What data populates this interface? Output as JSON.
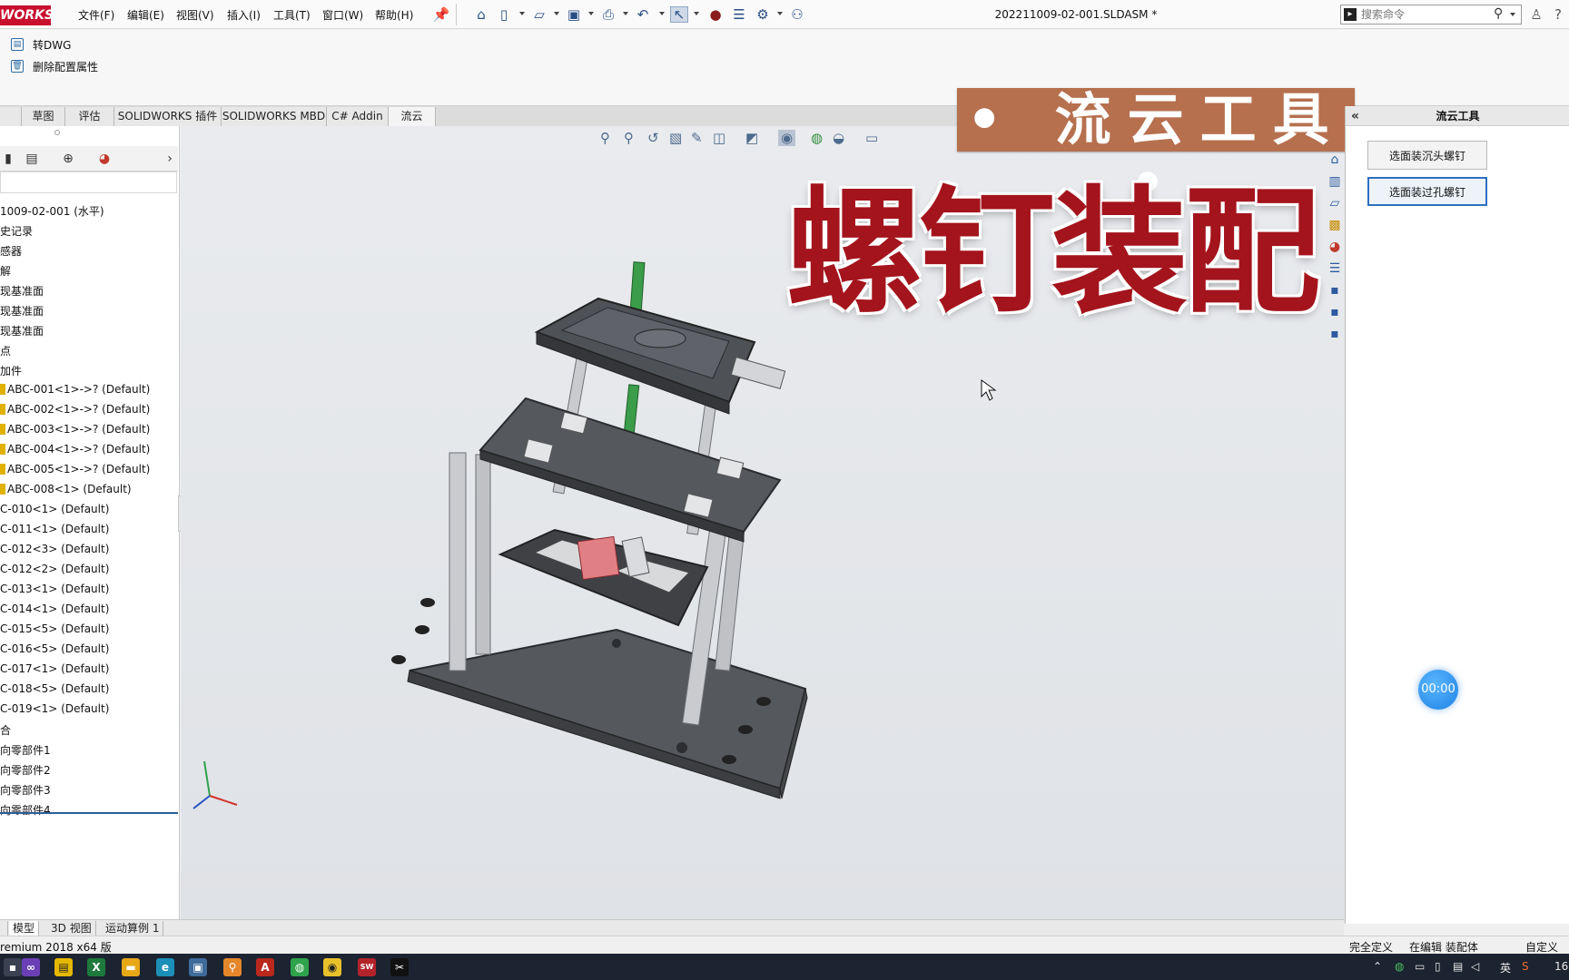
{
  "titlebar": {
    "brand": "WORKS",
    "menus": [
      "文件(F)",
      "编辑(E)",
      "视图(V)",
      "插入(I)",
      "工具(T)",
      "窗口(W)",
      "帮助(H)"
    ],
    "document_title": "202211009-02-001.SLDASM *",
    "search_placeholder": "搜索命令"
  },
  "ribbon": {
    "items": [
      {
        "label": "转DWG",
        "icon": "document-icon"
      },
      {
        "label": "删除配置属性",
        "icon": "trash-icon"
      }
    ]
  },
  "command_tabs": [
    "草图",
    "评估",
    "SOLIDWORKS 插件",
    "SOLIDWORKS MBD",
    "C# Addin",
    "流云"
  ],
  "active_tab": "流云",
  "feature_tree": {
    "items": [
      "1009-02-001  (水平)",
      "史记录",
      "感器",
      "解",
      "现基准面",
      "现基准面",
      "现基准面",
      "点",
      "加件",
      "ABC-001<1>->? (Default)",
      "ABC-002<1>->? (Default)",
      "ABC-003<1>->? (Default)",
      "ABC-004<1>->? (Default)",
      "ABC-005<1>->? (Default)",
      "ABC-008<1> (Default)",
      "C-010<1> (Default)",
      "C-011<1> (Default)",
      "C-012<3> (Default)",
      "C-012<2> (Default)",
      "C-013<1> (Default)",
      "C-014<1> (Default)",
      "C-015<5> (Default)",
      "C-016<5> (Default)",
      "C-017<1> (Default)",
      "C-018<5> (Default)",
      "C-019<1> (Default)",
      "合",
      "向零部件1",
      "向零部件2",
      "向零部件3",
      "向零部件4"
    ]
  },
  "overlay": {
    "banner": "• 流云工具 •",
    "headline": "螺钉装配"
  },
  "task_pane": {
    "title": "流云工具",
    "buttons": [
      "选面装沉头螺钉",
      "选面装过孔螺钉"
    ]
  },
  "timer": "00:00",
  "bottom_tabs": [
    "模型",
    "3D 视图",
    "运动算例 1"
  ],
  "status_bar": {
    "left": "remium 2018 x64 版",
    "right": [
      "完全定义",
      "在编辑 装配体",
      "自定义"
    ]
  },
  "taskbar": {
    "tray": [
      "英",
      "16"
    ]
  }
}
